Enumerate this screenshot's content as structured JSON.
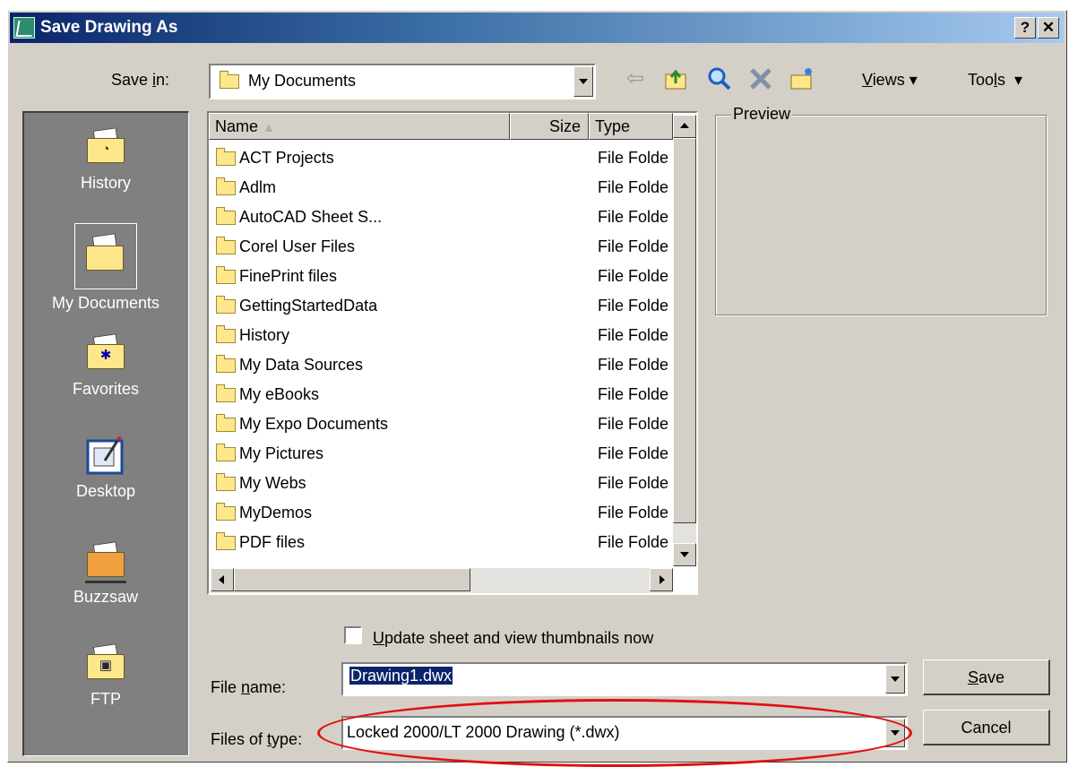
{
  "window": {
    "title": "Save Drawing As",
    "help_button": "?",
    "close_button": "✕"
  },
  "save_in": {
    "label_prefix": "Save ",
    "label_mnemonic": "i",
    "label_suffix": "n:",
    "value": "My Documents"
  },
  "toolbar": {
    "back_icon": "back-arrow-icon",
    "up_icon": "up-one-level-icon",
    "search_icon": "search-web-icon",
    "delete_icon": "delete-icon",
    "new_folder_icon": "new-folder-icon",
    "views_mnemonic": "V",
    "views_rest": "iews",
    "tools_prefix": "Too",
    "tools_mnemonic": "l",
    "tools_suffix": "s"
  },
  "places": [
    {
      "label": "History",
      "icon": "history-icon"
    },
    {
      "label": "My Documents",
      "icon": "my-documents-icon",
      "selected": true
    },
    {
      "label": "Favorites",
      "icon": "favorites-icon"
    },
    {
      "label": "Desktop",
      "icon": "desktop-icon"
    },
    {
      "label": "Buzzsaw",
      "icon": "buzzsaw-icon"
    },
    {
      "label": "FTP",
      "icon": "ftp-icon"
    }
  ],
  "file_list": {
    "columns": {
      "name": "Name",
      "size": "Size",
      "type": "Type"
    },
    "rows": [
      {
        "name": "ACT Projects",
        "type": "File Folde"
      },
      {
        "name": "Adlm",
        "type": "File Folde"
      },
      {
        "name": "AutoCAD Sheet S...",
        "type": "File Folde"
      },
      {
        "name": "Corel User Files",
        "type": "File Folde"
      },
      {
        "name": "FinePrint files",
        "type": "File Folde"
      },
      {
        "name": "GettingStartedData",
        "type": "File Folde"
      },
      {
        "name": "History",
        "type": "File Folde"
      },
      {
        "name": "My Data Sources",
        "type": "File Folde"
      },
      {
        "name": "My eBooks",
        "type": "File Folde"
      },
      {
        "name": "My Expo Documents",
        "type": "File Folde"
      },
      {
        "name": "My Pictures",
        "type": "File Folde"
      },
      {
        "name": "My Webs",
        "type": "File Folde"
      },
      {
        "name": "MyDemos",
        "type": "File Folde"
      },
      {
        "name": "PDF files",
        "type": "File Folde"
      }
    ]
  },
  "preview": {
    "label": "Preview"
  },
  "update_thumbnails": {
    "mnemonic": "U",
    "rest": "pdate sheet and view thumbnails now",
    "checked": false
  },
  "file_name": {
    "label_prefix": "File ",
    "label_mnemonic": "n",
    "label_suffix": "ame:",
    "value": "Drawing1.dwx"
  },
  "file_type": {
    "label_prefix": "Files of ",
    "label_mnemonic": "t",
    "label_suffix": "ype:",
    "value": "Locked 2000/LT 2000 Drawing (*.dwx)"
  },
  "buttons": {
    "save_mnemonic": "S",
    "save_rest": "ave",
    "cancel": "Cancel"
  },
  "colors": {
    "title_bar_start": "#0a246a",
    "title_bar_end": "#a6caf0",
    "dialog_bg": "#d4d0c8",
    "places_bg": "#808080",
    "annotation_oval": "#e01010"
  }
}
